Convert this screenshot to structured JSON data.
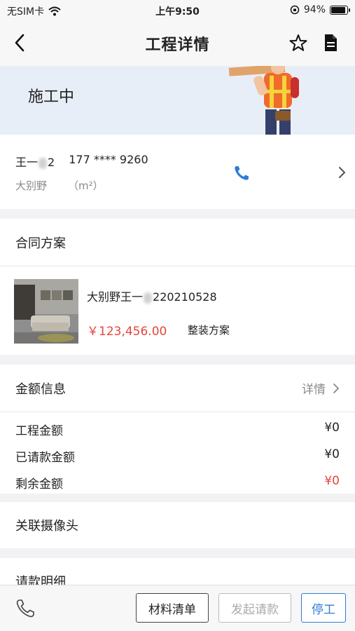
{
  "status_bar": {
    "carrier": "无SIM卡",
    "time": "上午9:50",
    "battery": "94%",
    "battery_level": 0.94
  },
  "navbar": {
    "title": "工程详情",
    "icons": [
      "back-icon",
      "star-icon",
      "document-icon"
    ]
  },
  "banner": {
    "status": "施工中"
  },
  "customer": {
    "name_prefix": "王一",
    "name_suffix": "2",
    "phone": "177 **** 9260",
    "house_type": "大别野",
    "area_unit": "（m²）"
  },
  "contract": {
    "section_title": "合同方案",
    "plan_name_prefix": "大别野王一",
    "plan_name_suffix": "220210528",
    "price": "￥123,456.00",
    "plan_type": "整装方案"
  },
  "amount_info": {
    "section_title": "金额信息",
    "detail_link": "详情",
    "rows": [
      {
        "label": "工程金额",
        "value": "¥0"
      },
      {
        "label": "已请款金额",
        "value": "¥0"
      },
      {
        "label": "剩余金额",
        "value": "¥0"
      }
    ],
    "accent_color": "#e5463c"
  },
  "camera": {
    "section_title": "关联摄像头"
  },
  "request_detail": {
    "section_title": "请款明细"
  },
  "bottom_bar": {
    "materials_label": "材料清单",
    "request_label": "发起请款",
    "stop_label": "停工"
  },
  "colors": {
    "link_blue": "#2f7bd6",
    "price_red": "#e5463c"
  }
}
